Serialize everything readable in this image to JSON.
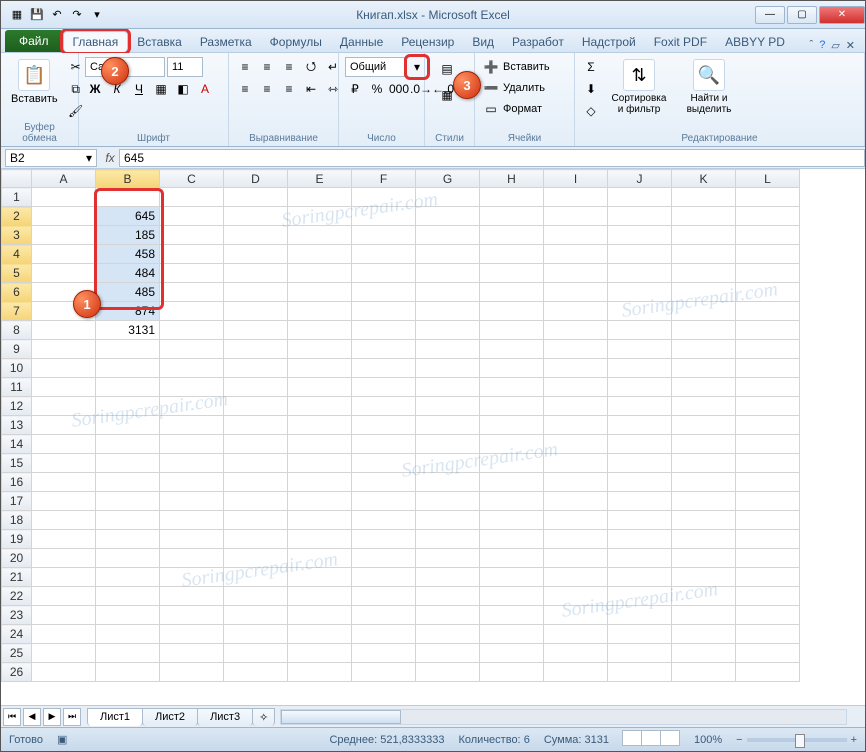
{
  "title": "Книгап.xlsx - Microsoft Excel",
  "tabs": {
    "file": "Файл",
    "home": "Главная",
    "insert": "Вставка",
    "layout": "Разметка",
    "formulas": "Формулы",
    "data": "Данные",
    "review": "Рецензир",
    "view": "Вид",
    "developer": "Разработ",
    "addins": "Надстрой",
    "foxit": "Foxit PDF",
    "abbyy": "ABBYY PD"
  },
  "ribbon": {
    "clipboard": {
      "paste": "Вставить",
      "label": "Буфер обмена"
    },
    "font": {
      "name": "Calibri",
      "size": "11",
      "label": "Шрифт"
    },
    "alignment": {
      "label": "Выравнивание"
    },
    "number": {
      "format": "Общий",
      "label": "Число"
    },
    "styles": {
      "label": "Стили"
    },
    "cells": {
      "insert": "Вставить",
      "delete": "Удалить",
      "format": "Формат",
      "label": "Ячейки"
    },
    "editing": {
      "sort": "Сортировка и фильтр",
      "find": "Найти и выделить",
      "label": "Редактирование"
    }
  },
  "formula_bar": {
    "cell_ref": "B2",
    "value": "645"
  },
  "columns": [
    "A",
    "B",
    "C",
    "D",
    "E",
    "F",
    "G",
    "H",
    "I",
    "J",
    "K",
    "L"
  ],
  "rows": [
    {
      "n": 1
    },
    {
      "n": 2,
      "b": "645"
    },
    {
      "n": 3,
      "b": "185"
    },
    {
      "n": 4,
      "b": "458"
    },
    {
      "n": 5,
      "b": "484"
    },
    {
      "n": 6,
      "b": "485"
    },
    {
      "n": 7,
      "b": "874"
    },
    {
      "n": 8,
      "b": "3131"
    },
    {
      "n": 9
    },
    {
      "n": 10
    },
    {
      "n": 11
    },
    {
      "n": 12
    },
    {
      "n": 13
    },
    {
      "n": 14
    },
    {
      "n": 15
    },
    {
      "n": 16
    },
    {
      "n": 17
    },
    {
      "n": 18
    },
    {
      "n": 19
    },
    {
      "n": 20
    },
    {
      "n": 21
    },
    {
      "n": 22
    },
    {
      "n": 23
    },
    {
      "n": 24
    },
    {
      "n": 25
    },
    {
      "n": 26
    }
  ],
  "selection": {
    "range": "B2:B7"
  },
  "callouts": {
    "c1": "1",
    "c2": "2",
    "c3": "3"
  },
  "sheets": {
    "s1": "Лист1",
    "s2": "Лист2",
    "s3": "Лист3"
  },
  "status": {
    "ready": "Готово",
    "average_label": "Среднее:",
    "average": "521,8333333",
    "count_label": "Количество:",
    "count": "6",
    "sum_label": "Сумма:",
    "sum": "3131",
    "zoom": "100%"
  },
  "watermark": "Soringpcrepair.com"
}
